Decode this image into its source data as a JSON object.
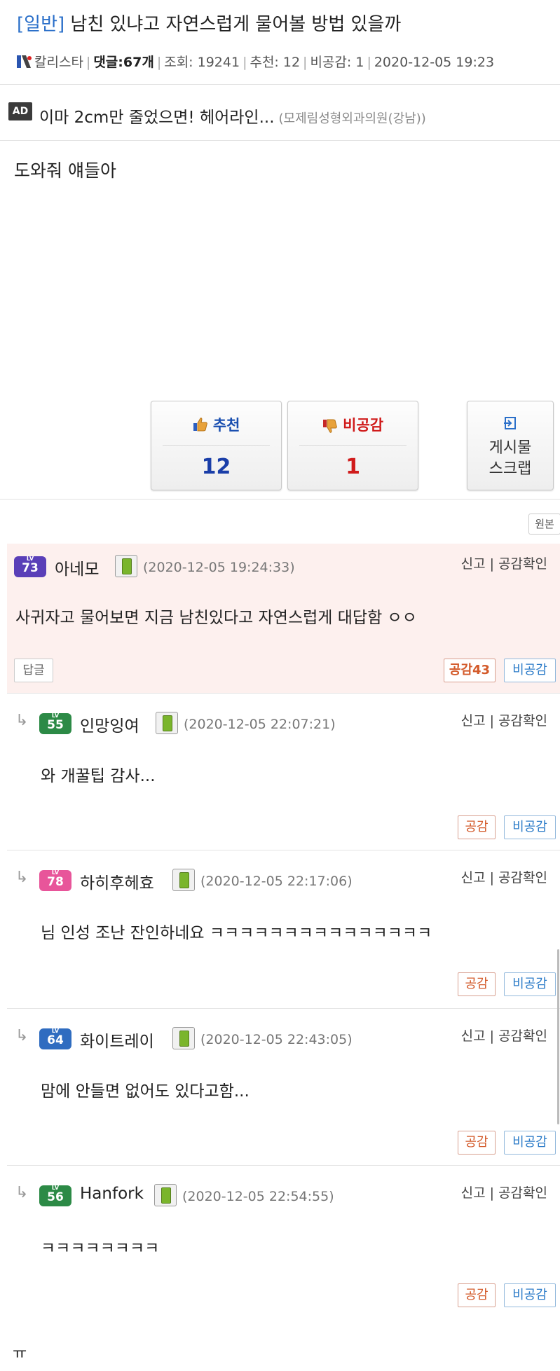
{
  "post": {
    "category": "[일반]",
    "title": "남친 있냐고 자연스럽게 물어볼 방법 있을까",
    "author": "칼리스타",
    "comments_label": "댓글:",
    "comments_count": "67개",
    "views": "조회: 19241",
    "recommend": "추천: 12",
    "dislike": "비공감: 1",
    "date": "2020-12-05 19:23",
    "body": "도와줘 얘들아"
  },
  "ad": {
    "badge": "AD",
    "text": "이마 2cm만 줄었으면! 헤어라인...",
    "source": "(모제림성형외과의원(강남))"
  },
  "votes": {
    "up_label": "추천",
    "up_count": "12",
    "down_label": "비공감",
    "down_count": "1",
    "scrap_line1": "게시물",
    "scrap_line2": "스크랩",
    "original_button": "원본"
  },
  "comment_actions": {
    "report": "신고 | 공감확인",
    "like": "공감",
    "dislike": "비공감",
    "reply": "답글"
  },
  "comments": [
    {
      "level": "73",
      "nick": "아네모",
      "date": "(2020-12-05 19:24:33)",
      "text": "사귀자고 물어보면 지금 남친있다고 자연스럽게 대답함 ㅇㅇ",
      "like": "공감43"
    },
    {
      "level": "55",
      "nick": "인망잉여",
      "date": "(2020-12-05 22:07:21)",
      "text": "와 개꿀팁 감사..."
    },
    {
      "level": "78",
      "nick": "하히후헤효",
      "date": "(2020-12-05 22:17:06)",
      "text": "님 인성 조난 잔인하네요 ㅋㅋㅋㅋㅋㅋㅋㅋㅋㅋㅋㅋㅋㅋㅋ"
    },
    {
      "level": "64",
      "nick": "화이트레이",
      "date": "(2020-12-05 22:43:05)",
      "text": "맘에 안들면 없어도 있다고함..."
    },
    {
      "level": "56",
      "nick": "Hanfork",
      "date": "(2020-12-05 22:54:55)",
      "text": "ㅋㅋㅋㅋㅋㅋㅋㅋ"
    }
  ],
  "tail_text": "ㅠ",
  "colors": {
    "category": "#2a6fc9",
    "recommend": "#1a3ea8",
    "dislike": "#d01b1b",
    "like_button": "#d35a2a",
    "dislike_button": "#2b7bc8",
    "highlight": "#fdf0ee"
  },
  "icons": {
    "author": "author-icon",
    "thumbs_up": "thumbs-up-icon",
    "thumbs_down": "thumbs-down-icon",
    "scrap": "scrap-icon",
    "phone": "mobile-icon",
    "reply_arrow": "reply-arrow-icon"
  }
}
